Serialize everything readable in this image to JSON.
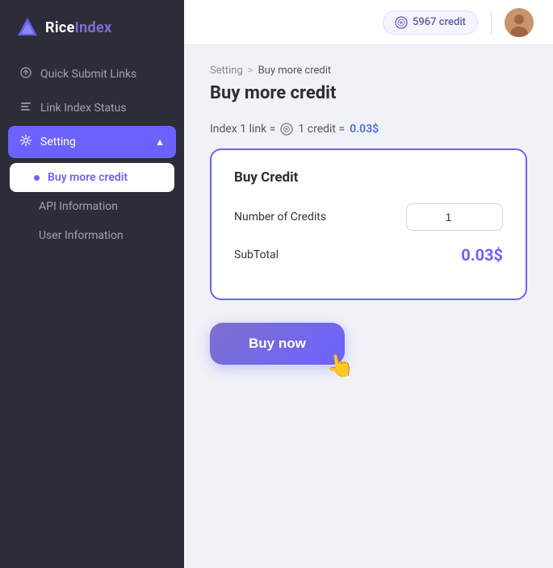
{
  "sidebar": {
    "logo": {
      "brand": "Rice",
      "brand2": "Index"
    },
    "items": [
      {
        "id": "quick-submit",
        "label": "Quick Submit Links",
        "icon": "⟳"
      },
      {
        "id": "link-index",
        "label": "Link Index Status",
        "icon": "⊞"
      },
      {
        "id": "setting",
        "label": "Setting",
        "icon": "⚙",
        "active": true,
        "hasChevron": true
      }
    ],
    "sub_items": [
      {
        "id": "buy-more-credit",
        "label": "Buy more credit",
        "active": true
      },
      {
        "id": "api-information",
        "label": "API Information"
      },
      {
        "id": "user-information",
        "label": "User Information"
      }
    ]
  },
  "header": {
    "credit_amount": "5967 credit",
    "credit_icon": "💳"
  },
  "breadcrumb": {
    "parent": "Setting",
    "separator": ">",
    "current": "Buy more credit"
  },
  "page": {
    "title": "Buy more credit",
    "info_text": "Index 1 link =",
    "info_credit": "1 credit =",
    "info_price": "0.03$",
    "card": {
      "title": "Buy Credit",
      "number_of_credits_label": "Number of Credits",
      "number_of_credits_value": "1",
      "subtotal_label": "SubTotal",
      "subtotal_value": "0.03$"
    },
    "buy_button_label": "Buy now"
  }
}
